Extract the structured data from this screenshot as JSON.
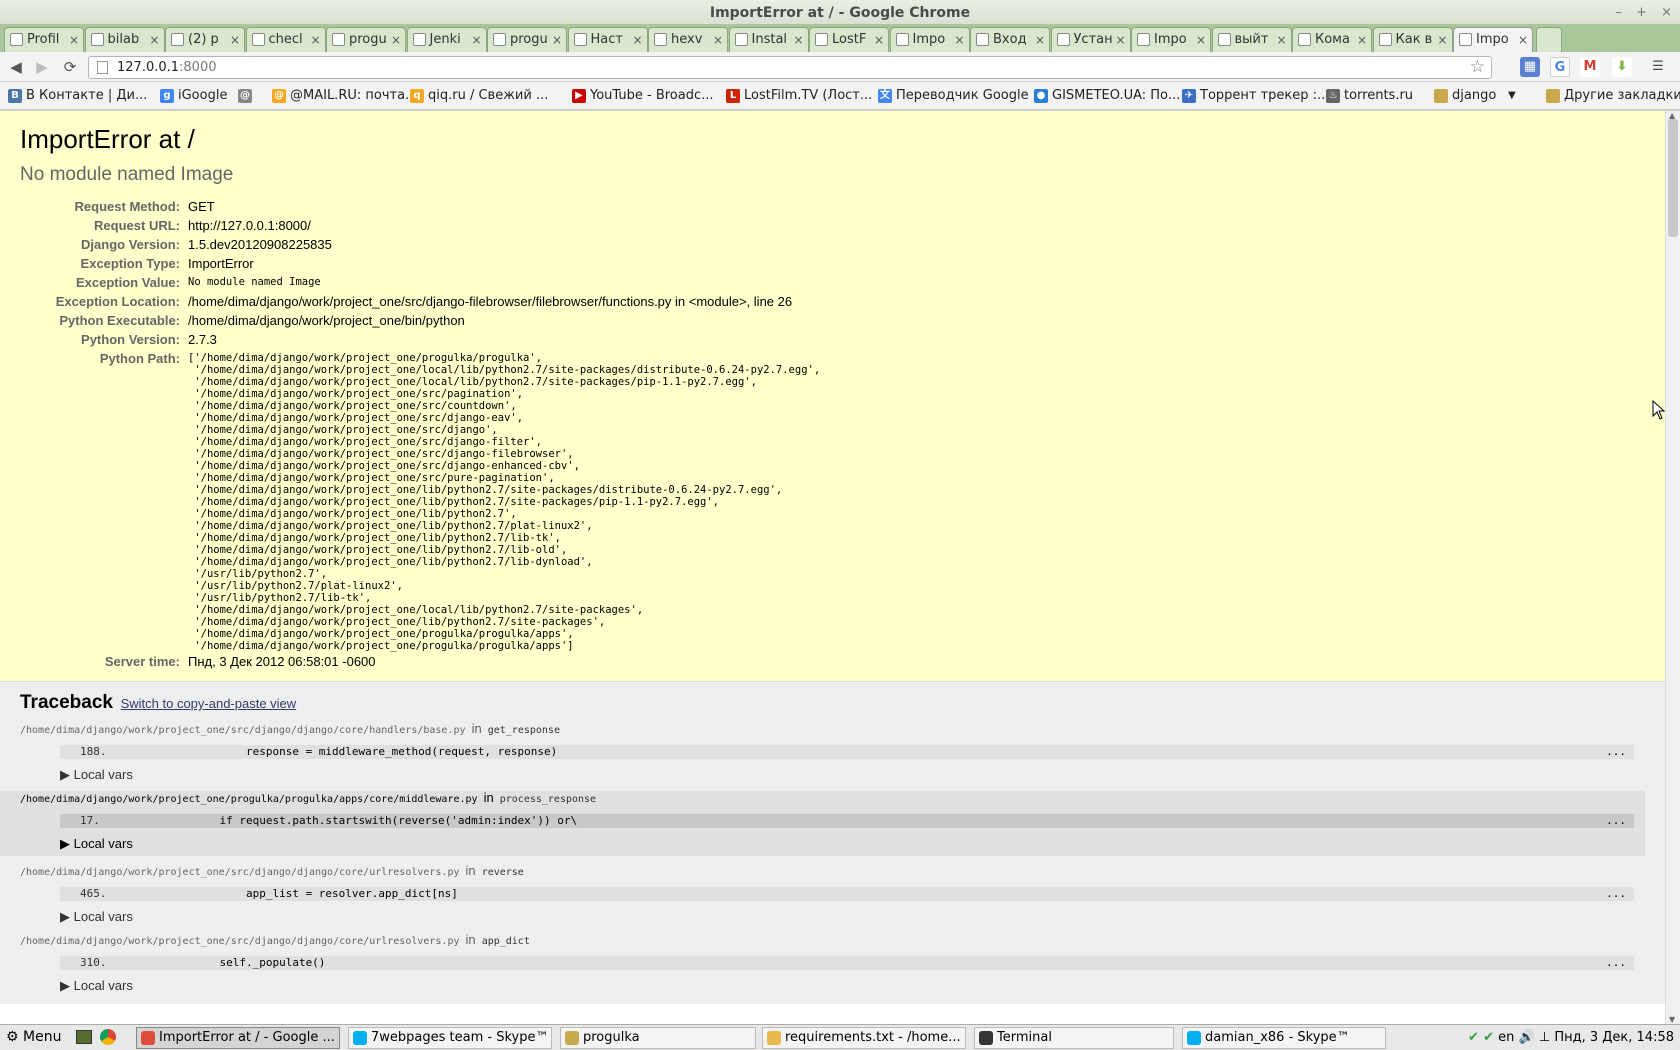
{
  "window": {
    "title": "ImportError at / - Google Chrome"
  },
  "tabs": [
    {
      "label": "Profil",
      "icon": "page-icon"
    },
    {
      "label": "bilab",
      "icon": "github-icon"
    },
    {
      "label": "(2) p",
      "icon": "trello-icon"
    },
    {
      "label": "checl",
      "icon": "trello-icon"
    },
    {
      "label": "progu",
      "icon": "jenkins-icon"
    },
    {
      "label": "Jenki",
      "icon": "jenkins-icon"
    },
    {
      "label": "progu",
      "icon": "jenkins-icon"
    },
    {
      "label": "Наст",
      "icon": "habr-icon"
    },
    {
      "label": "hexv",
      "icon": "page-icon"
    },
    {
      "label": "Instal",
      "icon": "book-icon"
    },
    {
      "label": "LostF",
      "icon": "lostfilm-icon"
    },
    {
      "label": "Impo",
      "icon": "page-icon"
    },
    {
      "label": "Вход",
      "icon": "gmail-icon"
    },
    {
      "label": "Устан",
      "icon": "google-icon"
    },
    {
      "label": "Impo",
      "icon": "page-icon"
    },
    {
      "label": "выйт",
      "icon": "google-icon"
    },
    {
      "label": "Кома",
      "icon": "google-icon"
    },
    {
      "label": "Как в",
      "icon": "question-icon"
    },
    {
      "label": "Impo",
      "icon": "page-icon",
      "active": true
    }
  ],
  "toolbar": {
    "url_host": "127.0.0.1",
    "url_port": ":8000"
  },
  "bookmarks": [
    {
      "label": "В Контакте | Ди...",
      "color": "#4a76a8",
      "glyph": "B"
    },
    {
      "label": "iGoogle",
      "color": "#4285f4",
      "glyph": "g"
    },
    {
      "label": "",
      "color": "#888888",
      "glyph": "@"
    },
    {
      "label": "@MAIL.RU: почта...",
      "color": "#f5a623",
      "glyph": "@"
    },
    {
      "label": "qiq.ru / Свежий ...",
      "color": "#f5a623",
      "glyph": "q"
    },
    {
      "label": "YouTube - Broadc...",
      "color": "#cc0000",
      "glyph": "▶"
    },
    {
      "label": "LostFilm.TV (Лост...",
      "color": "#cc2200",
      "glyph": "L"
    },
    {
      "label": "Переводчик Google",
      "color": "#4285f4",
      "glyph": "文"
    },
    {
      "label": "GISMETEO.UA: По...",
      "color": "#2a7fd4",
      "glyph": "●"
    },
    {
      "label": "Торрент трекер :...",
      "color": "#3a6fc4",
      "glyph": "✈"
    },
    {
      "label": "torrents.ru",
      "color": "#666666",
      "glyph": "♨"
    },
    {
      "label": "django",
      "color": "#c9a94d",
      "glyph": ""
    },
    {
      "label": "Другие закладки",
      "color": "#c9a94d",
      "glyph": ""
    }
  ],
  "error": {
    "title": "ImportError at /",
    "subtitle": "No module named Image",
    "meta": [
      {
        "label": "Request Method:",
        "value": "GET"
      },
      {
        "label": "Request URL:",
        "value": "http://127.0.0.1:8000/"
      },
      {
        "label": "Django Version:",
        "value": "1.5.dev20120908225835"
      },
      {
        "label": "Exception Type:",
        "value": "ImportError"
      },
      {
        "label": "Exception Value:",
        "value": "No module named Image",
        "mono": true
      },
      {
        "label": "Exception Location:",
        "value": "/home/dima/django/work/project_one/src/django-filebrowser/filebrowser/functions.py in <module>, line 26"
      },
      {
        "label": "Python Executable:",
        "value": "/home/dima/django/work/project_one/bin/python"
      },
      {
        "label": "Python Version:",
        "value": "2.7.3"
      }
    ],
    "python_path_label": "Python Path:",
    "python_path": "['/home/dima/django/work/project_one/progulka/progulka',\n '/home/dima/django/work/project_one/local/lib/python2.7/site-packages/distribute-0.6.24-py2.7.egg',\n '/home/dima/django/work/project_one/local/lib/python2.7/site-packages/pip-1.1-py2.7.egg',\n '/home/dima/django/work/project_one/src/pagination',\n '/home/dima/django/work/project_one/src/countdown',\n '/home/dima/django/work/project_one/src/django-eav',\n '/home/dima/django/work/project_one/src/django',\n '/home/dima/django/work/project_one/src/django-filter',\n '/home/dima/django/work/project_one/src/django-filebrowser',\n '/home/dima/django/work/project_one/src/django-enhanced-cbv',\n '/home/dima/django/work/project_one/src/pure-pagination',\n '/home/dima/django/work/project_one/lib/python2.7/site-packages/distribute-0.6.24-py2.7.egg',\n '/home/dima/django/work/project_one/lib/python2.7/site-packages/pip-1.1-py2.7.egg',\n '/home/dima/django/work/project_one/lib/python2.7',\n '/home/dima/django/work/project_one/lib/python2.7/plat-linux2',\n '/home/dima/django/work/project_one/lib/python2.7/lib-tk',\n '/home/dima/django/work/project_one/lib/python2.7/lib-old',\n '/home/dima/django/work/project_one/lib/python2.7/lib-dynload',\n '/usr/lib/python2.7',\n '/usr/lib/python2.7/plat-linux2',\n '/usr/lib/python2.7/lib-tk',\n '/home/dima/django/work/project_one/local/lib/python2.7/site-packages',\n '/home/dima/django/work/project_one/lib/python2.7/site-packages',\n '/home/dima/django/work/project_one/progulka/progulka/apps',\n '/home/dima/django/work/project_one/progulka/progulka/apps']",
    "server_time_label": "Server time:",
    "server_time": "Пнд, 3 Дек 2012 06:58:01 -0600"
  },
  "traceback": {
    "heading": "Traceback",
    "switch_link": "Switch to copy-and-paste view",
    "in_word": "in",
    "local_vars": "▶ Local vars",
    "ellipsis": "...",
    "frames": [
      {
        "file": "/home/dima/django/work/project_one/src/django/django/core/handlers/base.py",
        "func": "get_response",
        "line": "188.",
        "code": "                response = middleware_method(request, response)",
        "user": false
      },
      {
        "file": "/home/dima/django/work/project_one/progulka/progulka/apps/core/middleware.py",
        "func": "process_response",
        "line": "17.",
        "code": "            if request.path.startswith(reverse('admin:index')) or\\",
        "user": true
      },
      {
        "file": "/home/dima/django/work/project_one/src/django/django/core/urlresolvers.py",
        "func": "reverse",
        "line": "465.",
        "code": "                app_list = resolver.app_dict[ns]",
        "user": false
      },
      {
        "file": "/home/dima/django/work/project_one/src/django/django/core/urlresolvers.py",
        "func": "app_dict",
        "line": "310.",
        "code": "            self._populate()",
        "user": false
      }
    ]
  },
  "taskbar": {
    "menu_label": "Menu",
    "items": [
      {
        "label": "ImportError at / - Google ...",
        "color": "#dd4b39",
        "active": true
      },
      {
        "label": "7webpages team - Skype™",
        "color": "#00aff0"
      },
      {
        "label": "progulka",
        "color": "#c9a94d"
      },
      {
        "label": "requirements.txt - /home...",
        "color": "#e8b84a"
      },
      {
        "label": "Terminal",
        "color": "#333333"
      },
      {
        "label": "damian_x86 - Skype™",
        "color": "#00aff0"
      }
    ],
    "lang": "en",
    "clock": "Пнд, 3 Дек, 14:58"
  }
}
